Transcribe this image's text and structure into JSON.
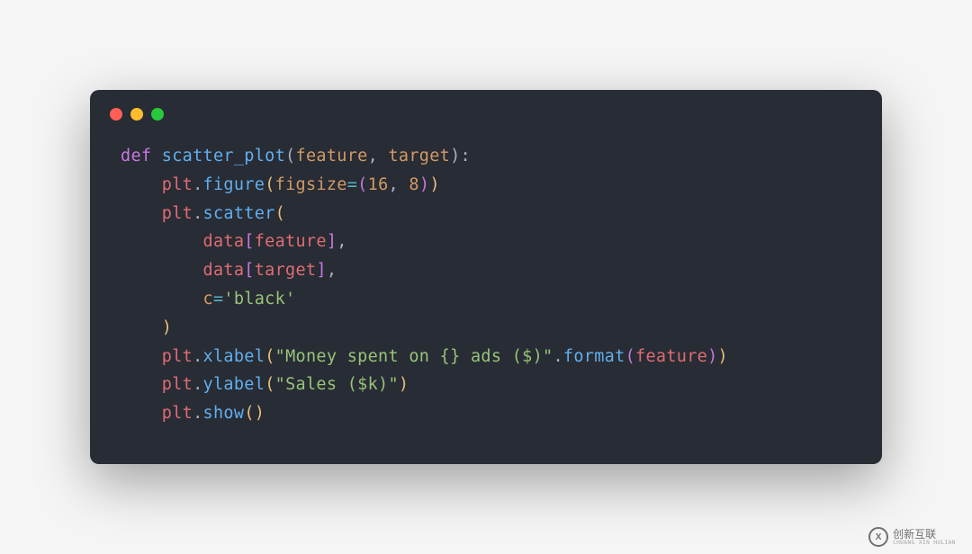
{
  "code": {
    "line1": {
      "kw_def": "def",
      "funcname": "scatter_plot",
      "param1": "feature",
      "param2": "target"
    },
    "line2": {
      "obj": "plt",
      "method": "figure",
      "kwarg": "figsize",
      "n1": "16",
      "n2": "8"
    },
    "line3": {
      "obj": "plt",
      "method": "scatter"
    },
    "line4": {
      "obj": "data",
      "key": "feature"
    },
    "line5": {
      "obj": "data",
      "key": "target"
    },
    "line6": {
      "kwarg": "c",
      "val": "'black'"
    },
    "line8": {
      "obj": "plt",
      "method": "xlabel",
      "str": "\"Money spent on {} ads ($)\"",
      "fmethod": "format",
      "farg": "feature"
    },
    "line9": {
      "obj": "plt",
      "method": "ylabel",
      "str": "\"Sales ($k)\""
    },
    "line10": {
      "obj": "plt",
      "method": "show"
    }
  },
  "watermark": {
    "logo_letter": "X",
    "main": "创新互联",
    "sub": "CHUANG XIN HULIAN"
  }
}
